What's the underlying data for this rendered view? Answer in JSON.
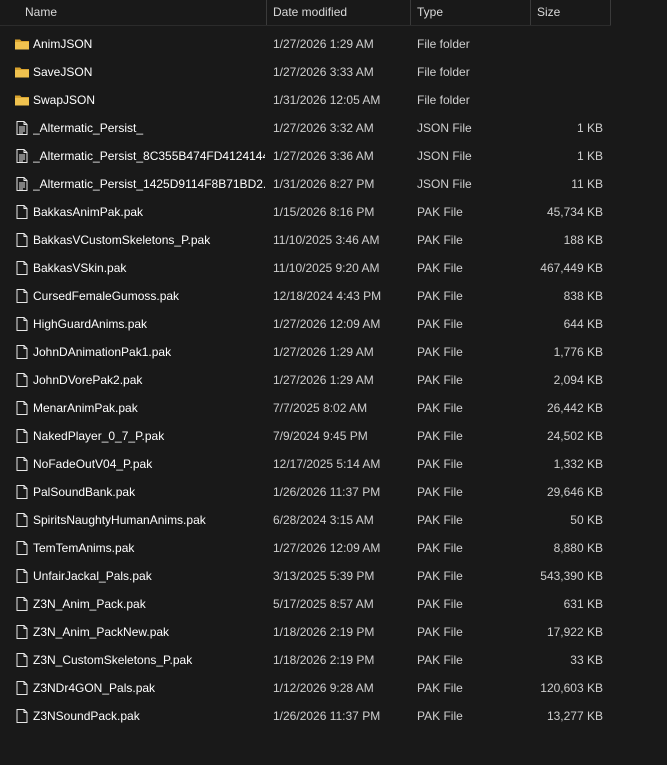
{
  "columns": {
    "name": "Name",
    "date": "Date modified",
    "type": "Type",
    "size": "Size"
  },
  "sort_indicator": "^",
  "colors": {
    "folder": "#f0c24f",
    "folder_dark": "#d9a32e",
    "file_icon": "#e8e8e8"
  },
  "files": [
    {
      "name": "AnimJSON",
      "date": "1/27/2026 1:29 AM",
      "type": "File folder",
      "size": "",
      "icon": "folder-icon"
    },
    {
      "name": "SaveJSON",
      "date": "1/27/2026 3:33 AM",
      "type": "File folder",
      "size": "",
      "icon": "folder-icon"
    },
    {
      "name": "SwapJSON",
      "date": "1/31/2026 12:05 AM",
      "type": "File folder",
      "size": "",
      "icon": "folder-icon"
    },
    {
      "name": "_Altermatic_Persist_",
      "date": "1/27/2026 3:32 AM",
      "type": "JSON File",
      "size": "1 KB",
      "icon": "text-file-icon"
    },
    {
      "name": "_Altermatic_Persist_8C355B474FD4124144...",
      "date": "1/27/2026 3:36 AM",
      "type": "JSON File",
      "size": "1 KB",
      "icon": "text-file-icon"
    },
    {
      "name": "_Altermatic_Persist_1425D9114F8B71BD2...",
      "date": "1/31/2026 8:27 PM",
      "type": "JSON File",
      "size": "11 KB",
      "icon": "text-file-icon"
    },
    {
      "name": "BakkasAnimPak.pak",
      "date": "1/15/2026 8:16 PM",
      "type": "PAK File",
      "size": "45,734 KB",
      "icon": "blank-file-icon"
    },
    {
      "name": "BakkasVCustomSkeletons_P.pak",
      "date": "11/10/2025 3:46 AM",
      "type": "PAK File",
      "size": "188 KB",
      "icon": "blank-file-icon"
    },
    {
      "name": "BakkasVSkin.pak",
      "date": "11/10/2025 9:20 AM",
      "type": "PAK File",
      "size": "467,449 KB",
      "icon": "blank-file-icon"
    },
    {
      "name": "CursedFemaleGumoss.pak",
      "date": "12/18/2024 4:43 PM",
      "type": "PAK File",
      "size": "838 KB",
      "icon": "blank-file-icon"
    },
    {
      "name": "HighGuardAnims.pak",
      "date": "1/27/2026 12:09 AM",
      "type": "PAK File",
      "size": "644 KB",
      "icon": "blank-file-icon"
    },
    {
      "name": "JohnDAnimationPak1.pak",
      "date": "1/27/2026 1:29 AM",
      "type": "PAK File",
      "size": "1,776 KB",
      "icon": "blank-file-icon"
    },
    {
      "name": "JohnDVorePak2.pak",
      "date": "1/27/2026 1:29 AM",
      "type": "PAK File",
      "size": "2,094 KB",
      "icon": "blank-file-icon"
    },
    {
      "name": "MenarAnimPak.pak",
      "date": "7/7/2025 8:02 AM",
      "type": "PAK File",
      "size": "26,442 KB",
      "icon": "blank-file-icon"
    },
    {
      "name": "NakedPlayer_0_7_P.pak",
      "date": "7/9/2024 9:45 PM",
      "type": "PAK File",
      "size": "24,502 KB",
      "icon": "blank-file-icon"
    },
    {
      "name": "NoFadeOutV04_P.pak",
      "date": "12/17/2025 5:14 AM",
      "type": "PAK File",
      "size": "1,332 KB",
      "icon": "blank-file-icon"
    },
    {
      "name": "PalSoundBank.pak",
      "date": "1/26/2026 11:37 PM",
      "type": "PAK File",
      "size": "29,646 KB",
      "icon": "blank-file-icon"
    },
    {
      "name": "SpiritsNaughtyHumanAnims.pak",
      "date": "6/28/2024 3:15 AM",
      "type": "PAK File",
      "size": "50 KB",
      "icon": "blank-file-icon"
    },
    {
      "name": "TemTemAnims.pak",
      "date": "1/27/2026 12:09 AM",
      "type": "PAK File",
      "size": "8,880 KB",
      "icon": "blank-file-icon"
    },
    {
      "name": "UnfairJackal_Pals.pak",
      "date": "3/13/2025 5:39 PM",
      "type": "PAK File",
      "size": "543,390 KB",
      "icon": "blank-file-icon"
    },
    {
      "name": "Z3N_Anim_Pack.pak",
      "date": "5/17/2025 8:57 AM",
      "type": "PAK File",
      "size": "631 KB",
      "icon": "blank-file-icon"
    },
    {
      "name": "Z3N_Anim_PackNew.pak",
      "date": "1/18/2026 2:19 PM",
      "type": "PAK File",
      "size": "17,922 KB",
      "icon": "blank-file-icon"
    },
    {
      "name": "Z3N_CustomSkeletons_P.pak",
      "date": "1/18/2026 2:19 PM",
      "type": "PAK File",
      "size": "33 KB",
      "icon": "blank-file-icon"
    },
    {
      "name": "Z3NDr4GON_Pals.pak",
      "date": "1/12/2026 9:28 AM",
      "type": "PAK File",
      "size": "120,603 KB",
      "icon": "blank-file-icon"
    },
    {
      "name": "Z3NSoundPack.pak",
      "date": "1/26/2026 11:37 PM",
      "type": "PAK File",
      "size": "13,277 KB",
      "icon": "blank-file-icon"
    }
  ]
}
